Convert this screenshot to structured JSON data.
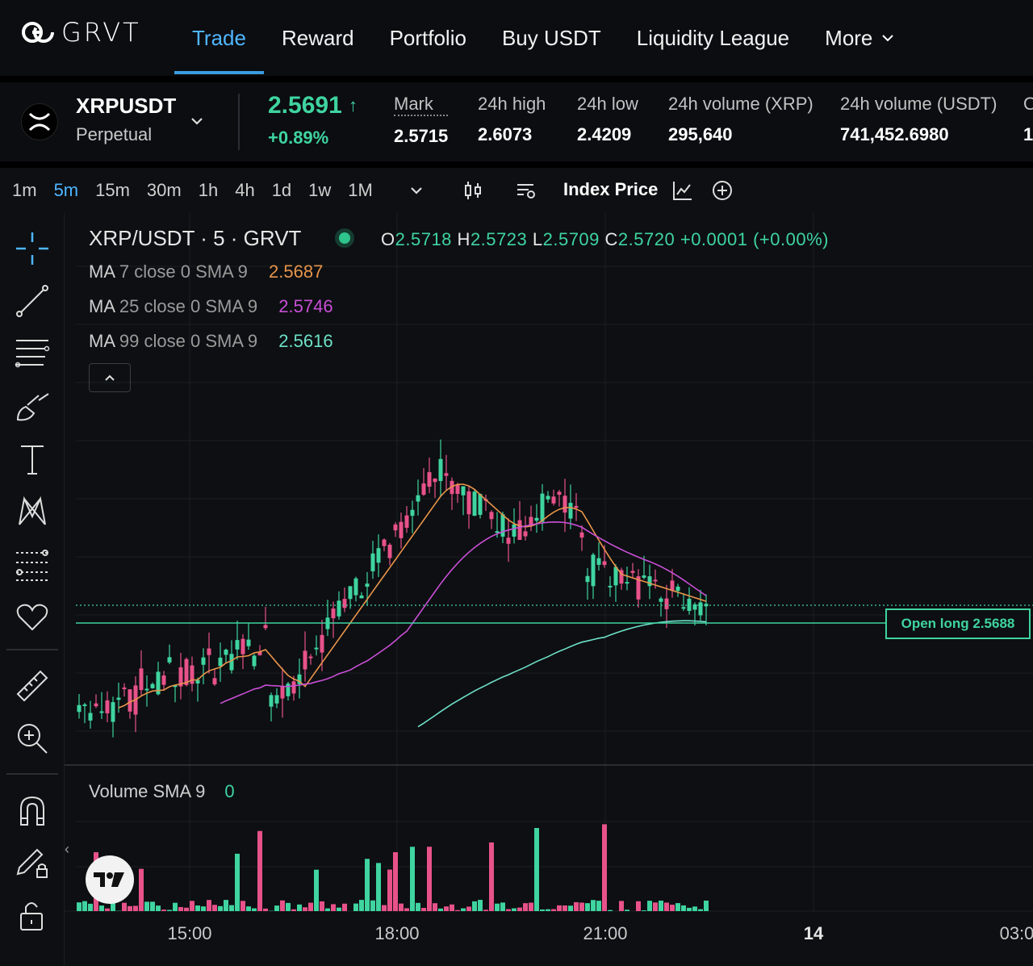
{
  "brand": {
    "logo_text": "GRVT"
  },
  "nav": {
    "items": [
      {
        "label": "Trade",
        "active": true
      },
      {
        "label": "Reward"
      },
      {
        "label": "Portfolio"
      },
      {
        "label": "Buy USDT"
      },
      {
        "label": "Liquidity League"
      },
      {
        "label": "More"
      }
    ]
  },
  "market": {
    "symbol": "XRPUSDT",
    "type": "Perpetual",
    "price": "2.5691",
    "price_arrow": "↑",
    "change": "+0.89%",
    "stats": [
      {
        "label": "Mark",
        "value": "2.5715"
      },
      {
        "label": "24h high",
        "value": "2.6073"
      },
      {
        "label": "24h low",
        "value": "2.4209"
      },
      {
        "label": "24h volume (XRP)",
        "value": "295,640"
      },
      {
        "label": "24h volume (USDT)",
        "value": "741,452.6980"
      },
      {
        "label": "O",
        "value": "1"
      }
    ]
  },
  "toolbar": {
    "timeframes": [
      "1m",
      "5m",
      "15m",
      "30m",
      "1h",
      "4h",
      "1d",
      "1w",
      "1M"
    ],
    "active_timeframe": "5m",
    "index_price_label": "Index Price"
  },
  "chart": {
    "legend_title": "XRP/USDT · 5 · GRVT",
    "ohlc": {
      "o_key": "O",
      "o": "2.5718",
      "h_key": "H",
      "h": "2.5723",
      "l_key": "L",
      "l": "2.5709",
      "c_key": "C",
      "c": "2.5720",
      "change": "+0.0001 (+0.00%)"
    },
    "ma": [
      {
        "name": "MA",
        "params": "7 close 0 SMA 9",
        "value": "2.5687",
        "color": "#e8944a"
      },
      {
        "name": "MA",
        "params": "25 close 0 SMA 9",
        "value": "2.5746",
        "color": "#c94fd6"
      },
      {
        "name": "MA",
        "params": "99 close 0 SMA 9",
        "value": "2.5616",
        "color": "#6ee0c8"
      }
    ],
    "volume_label": "Volume SMA 9",
    "volume_value": "0",
    "open_long_label": "Open long 2.5688",
    "x_labels": [
      {
        "text": "15:00"
      },
      {
        "text": "18:00"
      },
      {
        "text": "21:00"
      },
      {
        "text": "14",
        "bold": true
      },
      {
        "text": "03:0"
      }
    ],
    "colors": {
      "up": "#3fd4a0",
      "down": "#e8528a",
      "background": "#0d0f12"
    }
  }
}
